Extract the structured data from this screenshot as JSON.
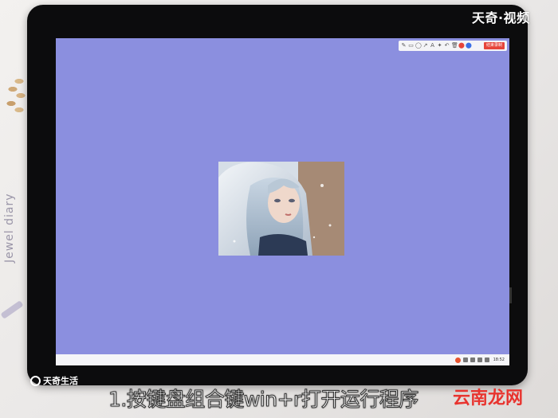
{
  "background": {
    "notebook_text": "Jewel diary"
  },
  "screen": {
    "color": "#8b8fdf",
    "toolbar": {
      "tools": [
        "✎",
        "▭",
        "◯",
        "↗",
        "A",
        "✦",
        "↶",
        "🗑",
        "⬤",
        "⬤",
        "📷"
      ],
      "stop_label": "结束录制"
    },
    "taskbar": {
      "time": "18:52"
    }
  },
  "overlay": {
    "top_logo": "天奇·视频",
    "bottom_logo": "天奇生活",
    "caption": "1.按键盘组合键win+r打开运行程序",
    "watermark": "云南龙网"
  },
  "colors": {
    "watermark": "#e8342f",
    "stop_button": "#e6443a"
  }
}
